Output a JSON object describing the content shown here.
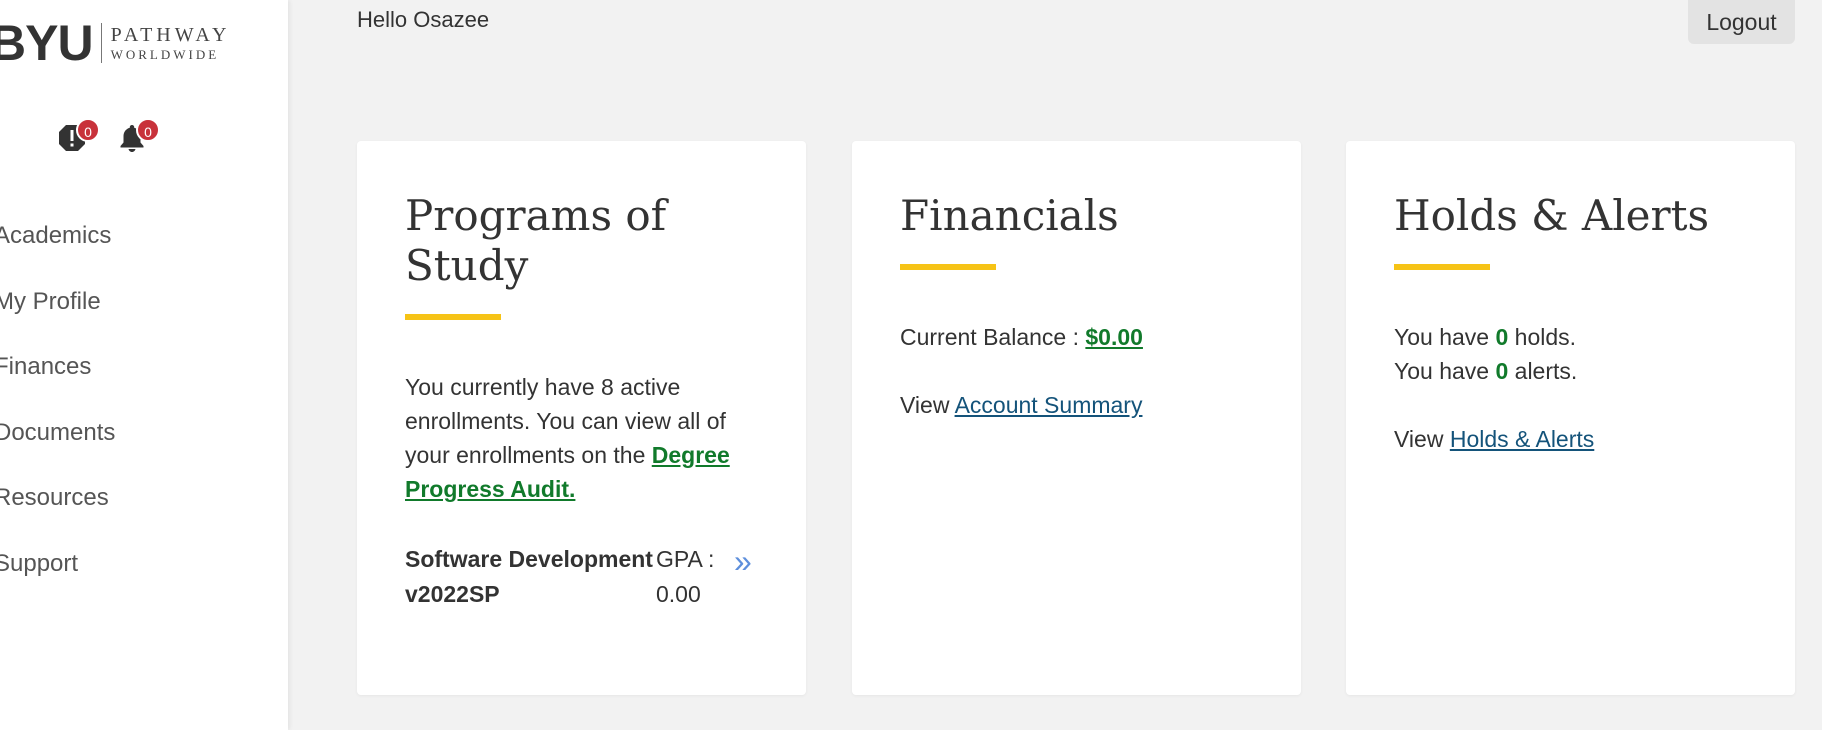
{
  "sidebar": {
    "logo": {
      "brand": "BYU",
      "line1": "PATHWAY",
      "line2": "WORLDWIDE"
    },
    "holds_badge": "0",
    "alerts_badge": "0",
    "nav": [
      {
        "label": "Academics"
      },
      {
        "label": "My Profile"
      },
      {
        "label": "Finances"
      },
      {
        "label": "Documents"
      },
      {
        "label": "Resources"
      },
      {
        "label": "Support"
      }
    ]
  },
  "header": {
    "greeting": "Hello Osazee",
    "logout_label": "Logout"
  },
  "programs_card": {
    "title": "Programs of Study",
    "text_before": "You currently have 8 active enrollments. You can view all of your enrollments on the ",
    "link_label": "Degree Progress Audit.",
    "program": {
      "name": "Software Development v2022SP",
      "gpa_label": "GPA :",
      "gpa_value": "0.00"
    }
  },
  "financials_card": {
    "title": "Financials",
    "balance_label": "Current Balance : ",
    "balance_value": "$0.00",
    "view_label": "View ",
    "link_label": "Account Summary"
  },
  "holds_card": {
    "title": "Holds & Alerts",
    "holds_pre": "You have ",
    "holds_count": "0",
    "holds_post": " holds.",
    "alerts_pre": "You have ",
    "alerts_count": "0",
    "alerts_post": " alerts.",
    "view_label": "View ",
    "link_label": "Holds & Alerts"
  },
  "colors": {
    "accent_underline": "#f6c316",
    "link_green": "#117a2b",
    "link_blue": "#14537a",
    "badge_red": "#c8323b"
  }
}
